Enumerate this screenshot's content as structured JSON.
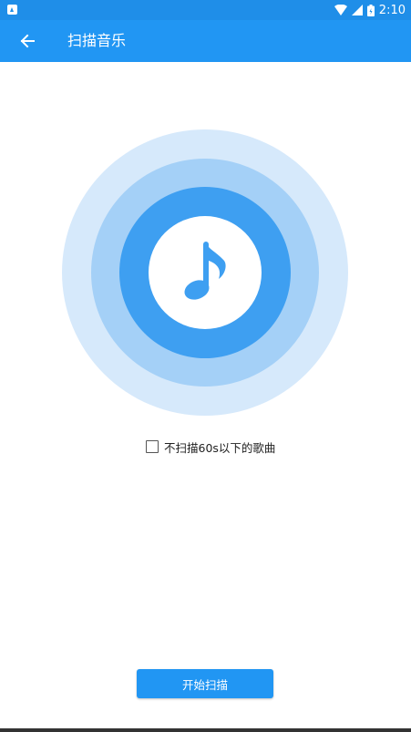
{
  "status_bar": {
    "time": "2:10"
  },
  "app_bar": {
    "title": "扫描音乐"
  },
  "icons": {
    "back": "arrow-left-icon",
    "note": "music-note-icon"
  },
  "options": {
    "skip_short_label": "不扫描60s以下的歌曲",
    "skip_short_checked": false
  },
  "actions": {
    "start_label": "开始扫描"
  },
  "colors": {
    "primary": "#2196f3",
    "status_bar": "#1f8ee8",
    "ring_outer": "#d6e9fb",
    "ring_middle": "#a4d0f7",
    "ring_inner": "#3e9ff1"
  }
}
